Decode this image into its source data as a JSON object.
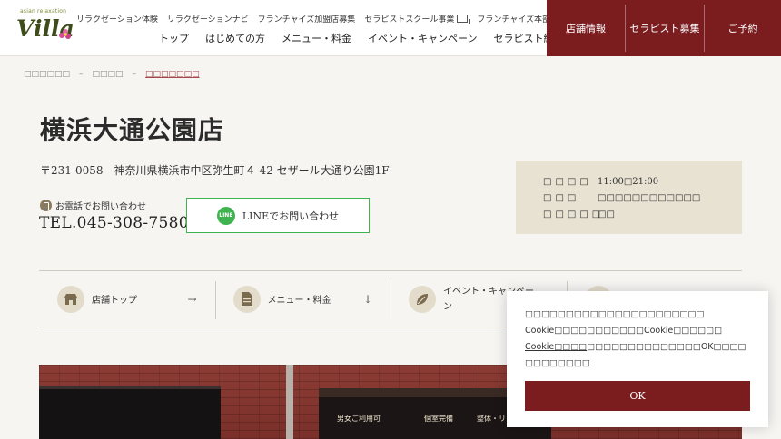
{
  "header": {
    "logo_small": "asian relaxation",
    "logo_text": "Villa",
    "sub_links": [
      "リラクゼーション体験",
      "リラクゼーションナビ",
      "フランチャイズ加盟店募集",
      "セラピストスクール事業",
      "フランチャイズ本部支援"
    ],
    "main_links": [
      "トップ",
      "はじめての方",
      "メニュー・料金",
      "イベント・キャンペーン",
      "セラピスト紹介"
    ],
    "red_buttons": [
      "店舗情報",
      "セラピスト募集",
      "ご予約"
    ]
  },
  "breadcrumb": [
    "□□□□□□",
    "□□□□",
    "□□□□□□□"
  ],
  "store": {
    "title": "横浜大通公園店",
    "address": "〒231-0058　神奈川県横浜市中区弥生町４-42 セザール大通り公園1F",
    "phone_label": "お電話でお問い合わせ",
    "phone": "TEL.045-308-7580",
    "line_label": "LINEでお問い合わせ",
    "line_icon_text": "LINE"
  },
  "hours": [
    {
      "label": "□□□□",
      "value": "11:00□21:00"
    },
    {
      "label": "□□□",
      "value": "□□□□□□□□□□□□"
    },
    {
      "label": "□□□□□",
      "value": "□□"
    }
  ],
  "subnav": [
    {
      "label": "店舗トップ",
      "icon": "store-icon",
      "arrow": "→"
    },
    {
      "label": "メニュー・料金",
      "icon": "document-icon",
      "arrow": "↓"
    },
    {
      "label": "イベント・キャンペーン",
      "icon": "leaf-icon",
      "arrow": ""
    },
    {
      "label": "",
      "icon": "",
      "arrow": ""
    }
  ],
  "photo": {
    "sign_texts": [
      "男女ご利用可",
      "個室完備",
      "整体・リラクゼーション"
    ]
  },
  "cookie": {
    "line1": "□□□□□□□□□□□□□□□□□□□□□□",
    "line2": "Cookie□□□□□□□□□□□Cookie□□□□□□",
    "link": "Cookie□□□□",
    "line3": "□□□□□□□□□□□□□□OK□□□□□□□□□□□□",
    "ok_label": "OK"
  },
  "colors": {
    "brand_red": "#7b1c1f",
    "line_green": "#3fb34f",
    "hours_bg": "#e8e2d3"
  }
}
